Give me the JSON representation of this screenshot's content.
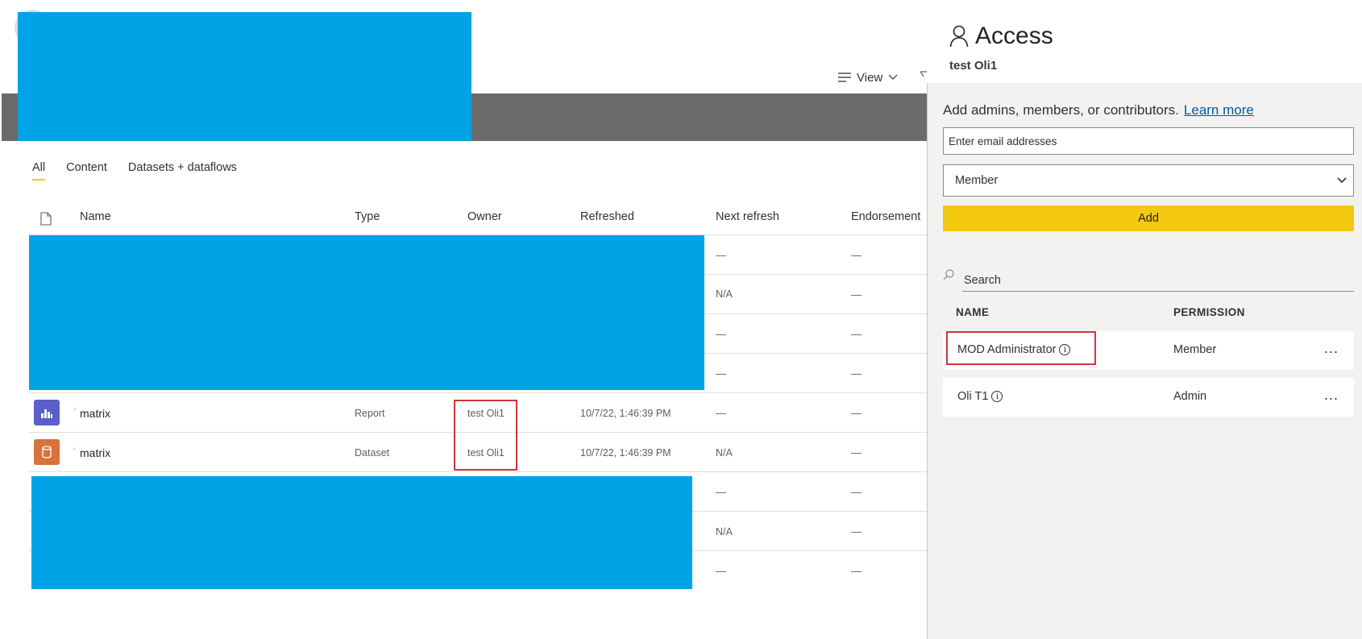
{
  "toolbar": {
    "view_label": "View"
  },
  "tabs": [
    {
      "label": "All",
      "active": true
    },
    {
      "label": "Content",
      "active": false
    },
    {
      "label": "Datasets + dataflows",
      "active": false
    }
  ],
  "table": {
    "columns": {
      "name": "Name",
      "type": "Type",
      "owner": "Owner",
      "refreshed": "Refreshed",
      "next_refresh": "Next refresh",
      "endorsement": "Endorsement"
    },
    "rows": [
      {
        "name": "",
        "type": "",
        "owner": "",
        "refreshed": "",
        "next_refresh": "—",
        "endorsement": "—"
      },
      {
        "name": "",
        "type": "",
        "owner": "",
        "refreshed": "",
        "next_refresh": "N/A",
        "endorsement": "—"
      },
      {
        "name": "",
        "type": "",
        "owner": "",
        "refreshed": "",
        "next_refresh": "—",
        "endorsement": "—"
      },
      {
        "name": "",
        "type": "",
        "owner": "",
        "refreshed": "",
        "next_refresh": "—",
        "endorsement": "—"
      },
      {
        "name": "matrix",
        "icon": "report-bar-icon",
        "type": "Report",
        "owner": "test Oli1",
        "refreshed": "10/7/22, 1:46:39 PM",
        "next_refresh": "—",
        "endorsement": "—"
      },
      {
        "name": "matrix",
        "icon": "dataset-cylinder-icon",
        "type": "Dataset",
        "owner": "test Oli1",
        "refreshed": "10/7/22, 1:46:39 PM",
        "next_refresh": "N/A",
        "endorsement": "—"
      },
      {
        "name": "",
        "type": "",
        "owner": "",
        "refreshed": "",
        "next_refresh": "—",
        "endorsement": "—"
      },
      {
        "name": "",
        "type": "",
        "owner": "",
        "refreshed": "",
        "next_refresh": "N/A",
        "endorsement": "—"
      },
      {
        "name": "",
        "type": "",
        "owner": "",
        "refreshed": "",
        "next_refresh": "—",
        "endorsement": "—"
      }
    ]
  },
  "access_panel": {
    "title": "Access",
    "workspace": "test Oli1",
    "add_text": "Add admins, members, or contributors.",
    "learn_more": "Learn more",
    "email_placeholder": "Enter email addresses",
    "role_selected": "Member",
    "add_button": "Add",
    "search_placeholder": "Search",
    "list_headers": {
      "name": "NAME",
      "permission": "PERMISSION"
    },
    "members": [
      {
        "name": "MOD Administrator",
        "permission": "Member",
        "more": "..."
      },
      {
        "name": "Oli T1",
        "permission": "Admin",
        "more": "..."
      }
    ]
  },
  "colors": {
    "accent_yellow": "#f2c811",
    "redaction_blue": "#00a3e6",
    "highlight_red": "#d13438",
    "report_icon_bg": "#5b5fc7",
    "dataset_icon_bg": "#d9713d"
  }
}
